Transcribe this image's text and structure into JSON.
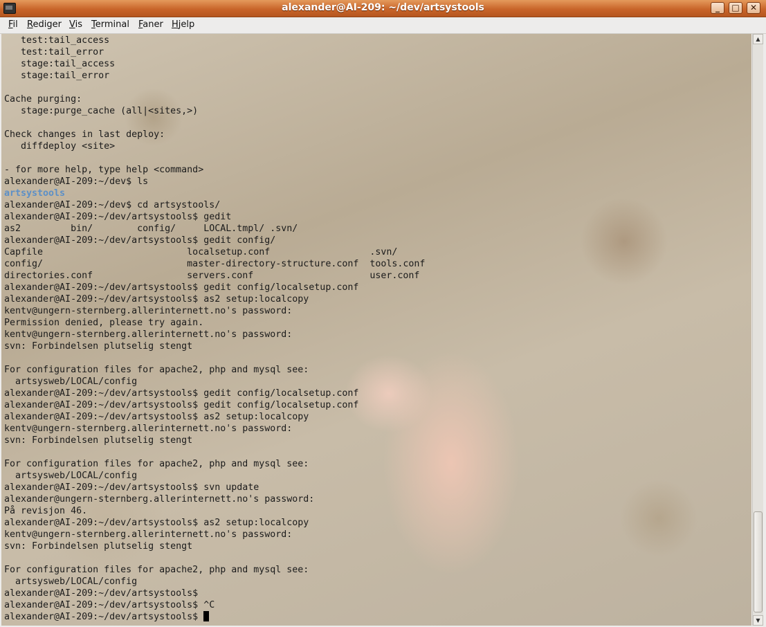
{
  "window": {
    "title": "alexander@AI-209: ~/dev/artsystools",
    "buttons": {
      "minimize": "_",
      "maximize": "□",
      "close": "✕"
    }
  },
  "menu": [
    {
      "label": "Fil"
    },
    {
      "label": "Rediger"
    },
    {
      "label": "Vis"
    },
    {
      "label": "Terminal"
    },
    {
      "label": "Faner"
    },
    {
      "label": "Hjelp"
    }
  ],
  "terminal": {
    "lines": [
      "   test:tail_access",
      "   test:tail_error",
      "   stage:tail_access",
      "   stage:tail_error",
      "",
      "Cache purging:",
      "   stage:purge_cache (all|<sites,>)",
      "",
      "Check changes in last deploy:",
      "   diffdeploy <site>",
      "",
      "- for more help, type help <command>",
      "alexander@AI-209:~/dev$ ls",
      "artsystools",
      "alexander@AI-209:~/dev$ cd artsystools/",
      "alexander@AI-209:~/dev/artsystools$ gedit",
      "as2         bin/        config/     LOCAL.tmpl/ .svn/",
      "alexander@AI-209:~/dev/artsystools$ gedit config/",
      "Capfile                          localsetup.conf                  .svn/",
      "config/                          master-directory-structure.conf  tools.conf",
      "directories.conf                 servers.conf                     user.conf",
      "alexander@AI-209:~/dev/artsystools$ gedit config/localsetup.conf",
      "alexander@AI-209:~/dev/artsystools$ as2 setup:localcopy",
      "kentv@ungern-sternberg.allerinternett.no's password:",
      "Permission denied, please try again.",
      "kentv@ungern-sternberg.allerinternett.no's password:",
      "svn: Forbindelsen plutselig stengt",
      "",
      "For configuration files for apache2, php and mysql see:",
      "  artsysweb/LOCAL/config",
      "alexander@AI-209:~/dev/artsystools$ gedit config/localsetup.conf",
      "alexander@AI-209:~/dev/artsystools$ gedit config/localsetup.conf",
      "alexander@AI-209:~/dev/artsystools$ as2 setup:localcopy",
      "kentv@ungern-sternberg.allerinternett.no's password:",
      "svn: Forbindelsen plutselig stengt",
      "",
      "For configuration files for apache2, php and mysql see:",
      "  artsysweb/LOCAL/config",
      "alexander@AI-209:~/dev/artsystools$ svn update",
      "alexander@ungern-sternberg.allerinternett.no's password:",
      "På revisjon 46.",
      "alexander@AI-209:~/dev/artsystools$ as2 setup:localcopy",
      "kentv@ungern-sternberg.allerinternett.no's password:",
      "svn: Forbindelsen plutselig stengt",
      "",
      "For configuration files for apache2, php and mysql see:",
      "  artsysweb/LOCAL/config",
      "alexander@AI-209:~/dev/artsystools$",
      "alexander@AI-209:~/dev/artsystools$ ^C",
      "alexander@AI-209:~/dev/artsystools$ "
    ],
    "directory_highlight_line": 13,
    "directory_color": "#5b8fc7"
  },
  "icons": {
    "app": "terminal-icon",
    "scroll_up": "scroll-up-arrow-icon",
    "scroll_down": "scroll-down-arrow-icon"
  },
  "colors": {
    "titlebar": "#c9652a",
    "menubar": "#edeceb",
    "text": "#1b1b1b"
  }
}
